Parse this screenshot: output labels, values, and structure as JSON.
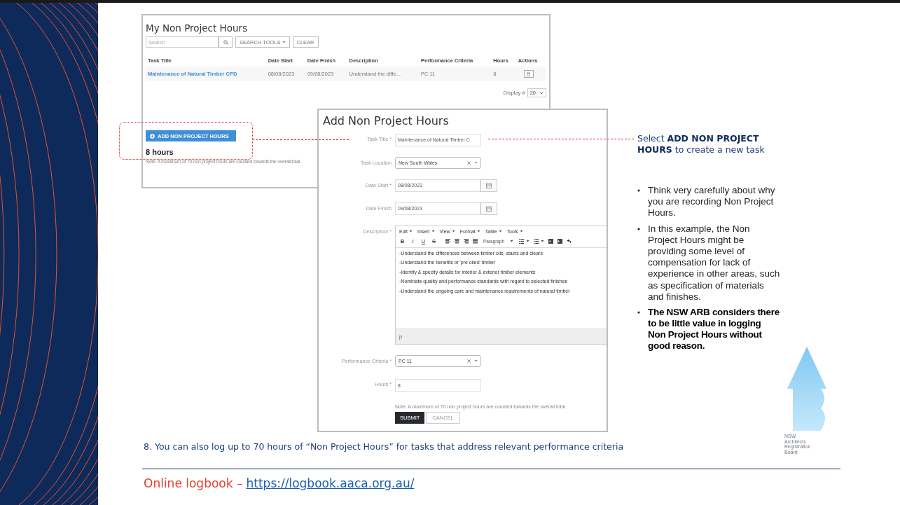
{
  "slide": {
    "list_panel": {
      "title": "My Non Project Hours",
      "search": {
        "placeholder": "Search"
      },
      "buttons": [
        "SEARCH TOOLS",
        "CLEAR"
      ],
      "table": {
        "columns": [
          "Task Title",
          "Date Start",
          "Date Finish",
          "Description",
          "Performance Criteria",
          "Hours",
          "Actions"
        ],
        "rows": [
          {
            "cells": [
              "Maintenance of Natural Timber CPD",
              "08/08/2023",
              "09/08/2023",
              "Understand the diffe...",
              "PC 11",
              "8"
            ]
          }
        ]
      },
      "display": {
        "label": "Display #",
        "value": "20"
      },
      "add_button": "ADD NON PROJECT HOURS",
      "total": "8 hours",
      "note": "Note: A maximum of 70 non project hours are counted towards the overall total."
    },
    "form_panel": {
      "title": "Add Non Project Hours",
      "fields": [
        {
          "kind": "text",
          "label": "Task Title *",
          "value": "Maintenance of Natural Timber C"
        },
        {
          "kind": "select",
          "label": "Task Location",
          "value": "New South Wales"
        },
        {
          "kind": "date",
          "label": "Date Start *",
          "value": "08/08/2023"
        },
        {
          "kind": "date",
          "label": "Date Finish",
          "value": "09/08/2023"
        },
        {
          "kind": "editor",
          "label": "Description *",
          "menus": [
            "Edit",
            "Insert",
            "View",
            "Format",
            "Table",
            "Tools"
          ],
          "format_buttons": [
            "B",
            "I",
            "U",
            "S"
          ],
          "block_style": "Paragraph",
          "lines": [
            "-Understand the differences between timber oils, stains and clears",
            "-Understand the benefits of 'pre oiled' timber",
            "-Identify & specify details for interior & exterior timber elements",
            "-Nominate quality and performance standards with regard to selected finishes",
            "-Understand the ongoing care and maintenance requirements of natural timber"
          ],
          "path": "p"
        },
        {
          "kind": "select",
          "label": "Performance Criteria *",
          "value": "PC 11"
        },
        {
          "kind": "text",
          "label": "Hours *",
          "value": "8"
        }
      ],
      "note": "Note: A maximum of 70 non project hours are counted towards the overall total.",
      "buttons": [
        "SUBMIT",
        "CANCEL"
      ]
    },
    "callout": "Select **ADD NON PROJECT HOURS** to create a new task",
    "bullets": [
      {
        "text": "Think very carefully about why you are recording Non Project Hours.",
        "bold": false
      },
      {
        "text": "In this example, the Non Project Hours might be providing some level of compensation for lack of experience in other areas, such as specification of materials and finishes.",
        "bold": false
      },
      {
        "text": "The NSW ARB considers there to be little value in logging Non Project Hours without good reason.",
        "bold": true
      }
    ],
    "logo_lines": [
      "NSW",
      "Architects",
      "Registration",
      "Board"
    ],
    "caption": "8. You can also log up to 70 hours of “Non Project Hours” for tasks that address relevant performance criteria",
    "footer": {
      "label": "Online logbook –",
      "link": "https://logbook.aaca.org.au/"
    }
  }
}
